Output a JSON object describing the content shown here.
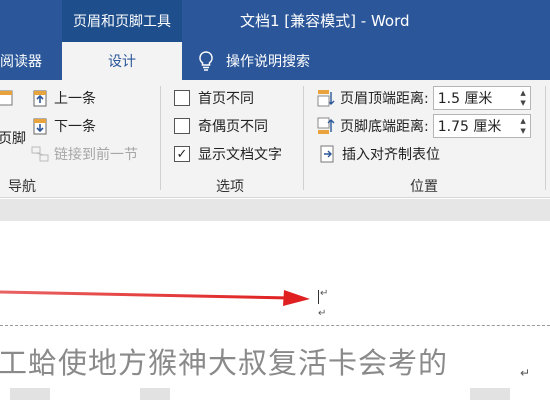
{
  "titlebar": {
    "context_group": "页眉和页脚工具",
    "doc_title": "文档1 [兼容模式]  -  Word"
  },
  "tabs": {
    "reader": "阅读器",
    "design": "设计",
    "search": "操作说明搜索"
  },
  "ribbon": {
    "navigation": {
      "group_label": "导航",
      "footer_partial": "页脚",
      "previous": "上一条",
      "next": "下一条",
      "link_previous": "链接到前一节"
    },
    "options": {
      "group_label": "选项",
      "different_first": "首页不同",
      "different_odd_even": "奇偶页不同",
      "show_doc_text": "显示文档文字",
      "show_doc_text_checked": true
    },
    "position": {
      "group_label": "位置",
      "header_top_label": "页眉顶端距离:",
      "header_top_value": "1.5 厘米",
      "footer_bottom_label": "页脚底端距离:",
      "footer_bottom_value": "1.75 厘米",
      "insert_align_tab": "插入对齐制表位"
    }
  },
  "document": {
    "body_line": "工蛤使地方猴神大叔复活卡会考的",
    "paragraph_mark": "↵"
  },
  "colors": {
    "accent": "#2b579a",
    "arrow": "#e02020"
  }
}
